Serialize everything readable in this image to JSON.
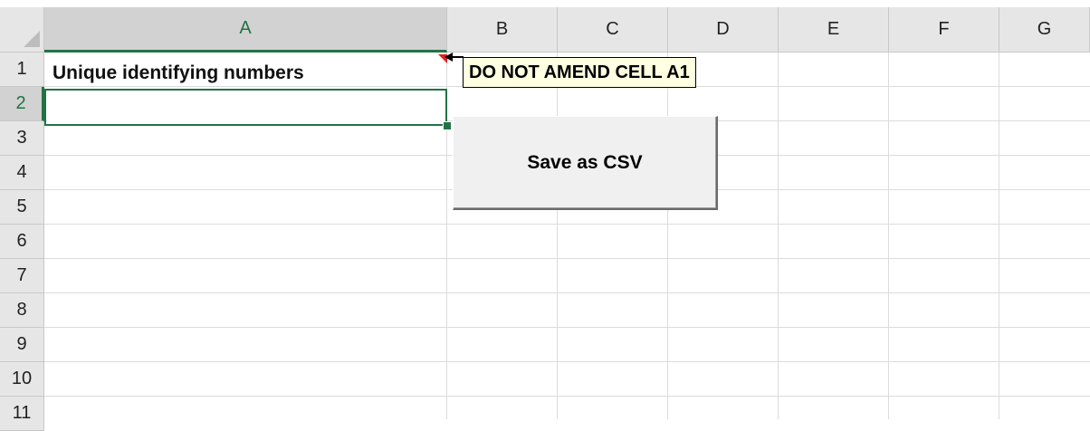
{
  "columns": [
    "A",
    "B",
    "C",
    "D",
    "E",
    "F",
    "G"
  ],
  "rows": [
    "1",
    "2",
    "3",
    "4",
    "5",
    "6",
    "7",
    "8",
    "9",
    "10",
    "11"
  ],
  "cells": {
    "A1": "Unique identifying numbers"
  },
  "comment": {
    "text": "DO NOT AMEND CELL A1"
  },
  "button": {
    "label": "Save as CSV"
  },
  "selection": {
    "active_cell": "A2",
    "active_column": "A",
    "active_row": "2"
  },
  "colors": {
    "accent": "#217346",
    "comment_background": "#ffffe1",
    "comment_indicator": "#e02020"
  }
}
